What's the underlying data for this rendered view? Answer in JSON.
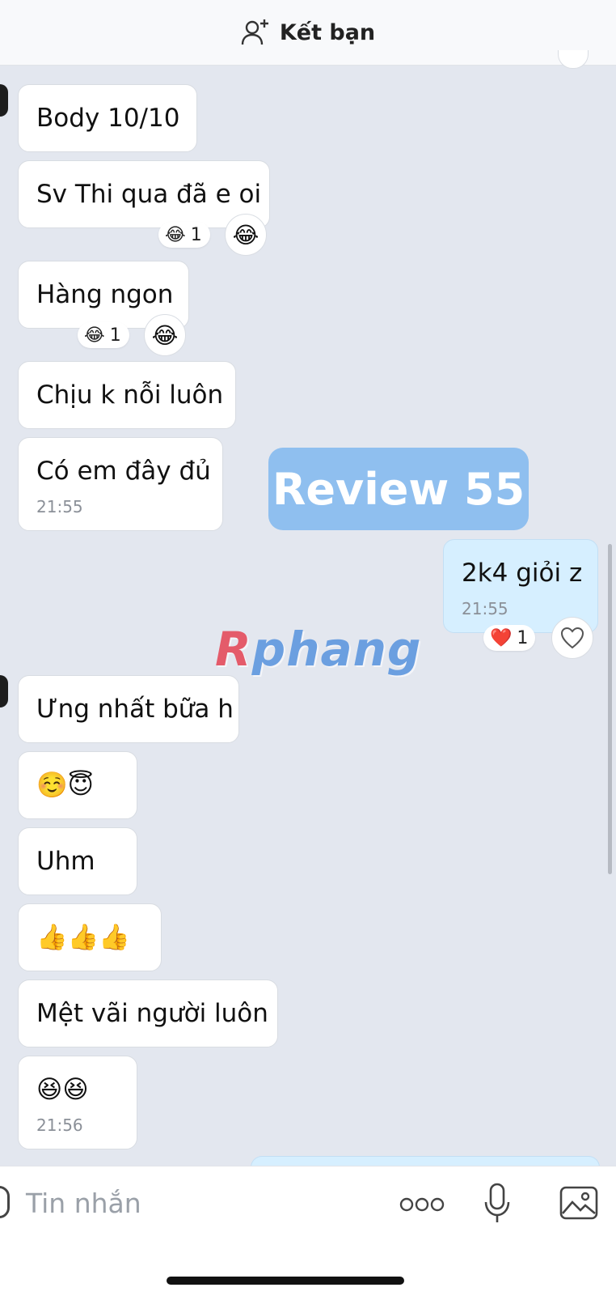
{
  "header": {
    "title": "Kết bạn",
    "add_icon": "add-friend-icon"
  },
  "messages": [
    {
      "text": "Body 10/10"
    },
    {
      "text": "Sv Thi qua đã e oi",
      "reaction": {
        "emoji": "😂",
        "count": "1"
      }
    },
    {
      "text": "Hàng ngon",
      "reaction": {
        "emoji": "😂",
        "count": "1"
      }
    },
    {
      "text": "Chịu k nỗi luôn"
    },
    {
      "text": "Có em đây đủ",
      "time": "21:55"
    },
    {
      "text": "2k4 giỏi z",
      "time": "21:55",
      "mine": true,
      "reaction": {
        "emoji": "❤️",
        "count": "1"
      }
    },
    {
      "text": "Ưng nhất bữa h"
    },
    {
      "text": "☺️😇"
    },
    {
      "text": "Uhm"
    },
    {
      "text": "👍👍👍"
    },
    {
      "text": "Mệt vãi người luôn"
    },
    {
      "text": "😆😆",
      "time": "21:56"
    }
  ],
  "watermark": {
    "review": "Review 55",
    "logo_r": "R",
    "logo_rest": "phang"
  },
  "composer": {
    "placeholder": "Tin nhắn",
    "icons": [
      "emoji-icon",
      "more-icon",
      "microphone-icon",
      "image-icon"
    ]
  },
  "colors": {
    "background": "#e3e7ef",
    "my_bubble": "#d6efff",
    "watermark_box": "#8fbfef"
  }
}
